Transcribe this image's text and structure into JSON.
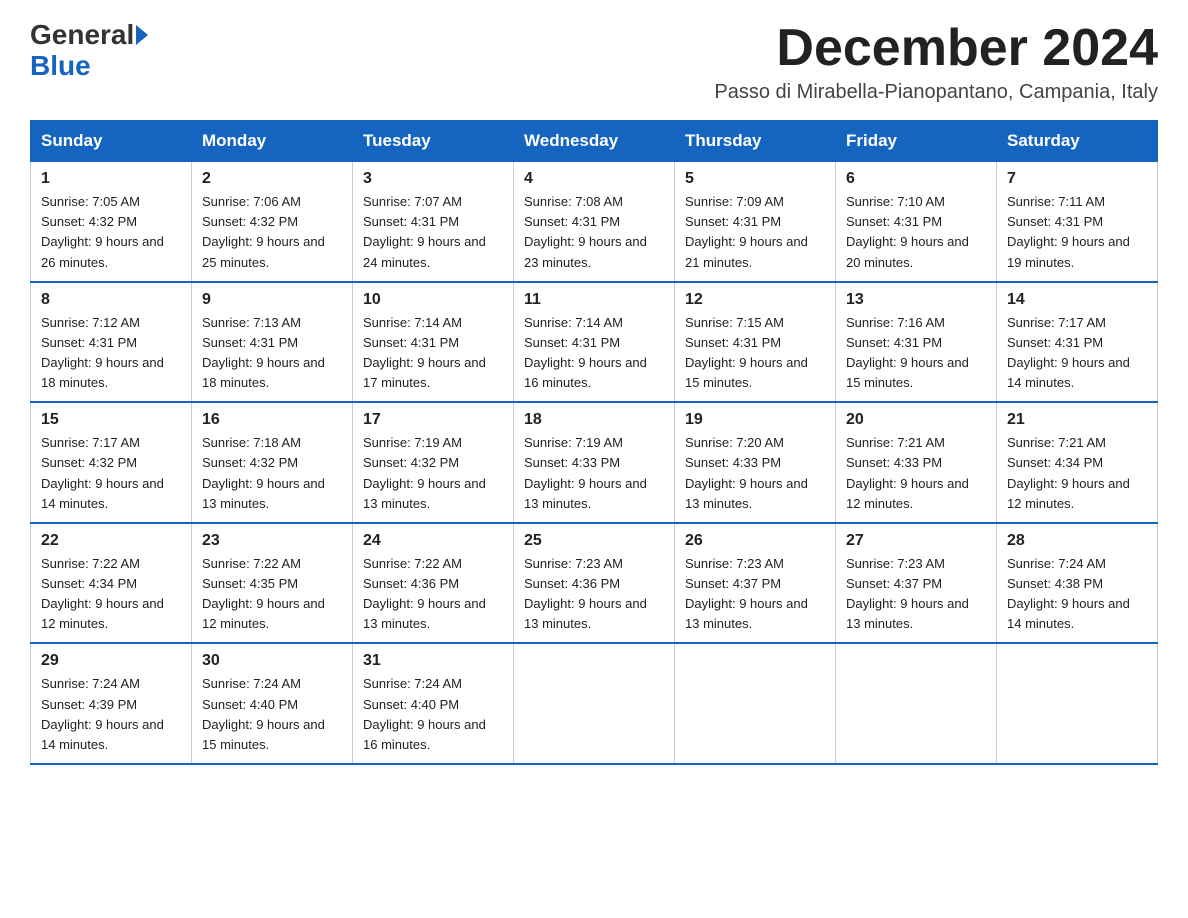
{
  "header": {
    "logo": {
      "general": "General",
      "blue": "Blue"
    },
    "title": "December 2024",
    "location": "Passo di Mirabella-Pianopantano, Campania, Italy"
  },
  "calendar": {
    "days_of_week": [
      "Sunday",
      "Monday",
      "Tuesday",
      "Wednesday",
      "Thursday",
      "Friday",
      "Saturday"
    ],
    "weeks": [
      [
        {
          "day": "1",
          "sunrise": "7:05 AM",
          "sunset": "4:32 PM",
          "daylight": "9 hours and 26 minutes."
        },
        {
          "day": "2",
          "sunrise": "7:06 AM",
          "sunset": "4:32 PM",
          "daylight": "9 hours and 25 minutes."
        },
        {
          "day": "3",
          "sunrise": "7:07 AM",
          "sunset": "4:31 PM",
          "daylight": "9 hours and 24 minutes."
        },
        {
          "day": "4",
          "sunrise": "7:08 AM",
          "sunset": "4:31 PM",
          "daylight": "9 hours and 23 minutes."
        },
        {
          "day": "5",
          "sunrise": "7:09 AM",
          "sunset": "4:31 PM",
          "daylight": "9 hours and 21 minutes."
        },
        {
          "day": "6",
          "sunrise": "7:10 AM",
          "sunset": "4:31 PM",
          "daylight": "9 hours and 20 minutes."
        },
        {
          "day": "7",
          "sunrise": "7:11 AM",
          "sunset": "4:31 PM",
          "daylight": "9 hours and 19 minutes."
        }
      ],
      [
        {
          "day": "8",
          "sunrise": "7:12 AM",
          "sunset": "4:31 PM",
          "daylight": "9 hours and 18 minutes."
        },
        {
          "day": "9",
          "sunrise": "7:13 AM",
          "sunset": "4:31 PM",
          "daylight": "9 hours and 18 minutes."
        },
        {
          "day": "10",
          "sunrise": "7:14 AM",
          "sunset": "4:31 PM",
          "daylight": "9 hours and 17 minutes."
        },
        {
          "day": "11",
          "sunrise": "7:14 AM",
          "sunset": "4:31 PM",
          "daylight": "9 hours and 16 minutes."
        },
        {
          "day": "12",
          "sunrise": "7:15 AM",
          "sunset": "4:31 PM",
          "daylight": "9 hours and 15 minutes."
        },
        {
          "day": "13",
          "sunrise": "7:16 AM",
          "sunset": "4:31 PM",
          "daylight": "9 hours and 15 minutes."
        },
        {
          "day": "14",
          "sunrise": "7:17 AM",
          "sunset": "4:31 PM",
          "daylight": "9 hours and 14 minutes."
        }
      ],
      [
        {
          "day": "15",
          "sunrise": "7:17 AM",
          "sunset": "4:32 PM",
          "daylight": "9 hours and 14 minutes."
        },
        {
          "day": "16",
          "sunrise": "7:18 AM",
          "sunset": "4:32 PM",
          "daylight": "9 hours and 13 minutes."
        },
        {
          "day": "17",
          "sunrise": "7:19 AM",
          "sunset": "4:32 PM",
          "daylight": "9 hours and 13 minutes."
        },
        {
          "day": "18",
          "sunrise": "7:19 AM",
          "sunset": "4:33 PM",
          "daylight": "9 hours and 13 minutes."
        },
        {
          "day": "19",
          "sunrise": "7:20 AM",
          "sunset": "4:33 PM",
          "daylight": "9 hours and 13 minutes."
        },
        {
          "day": "20",
          "sunrise": "7:21 AM",
          "sunset": "4:33 PM",
          "daylight": "9 hours and 12 minutes."
        },
        {
          "day": "21",
          "sunrise": "7:21 AM",
          "sunset": "4:34 PM",
          "daylight": "9 hours and 12 minutes."
        }
      ],
      [
        {
          "day": "22",
          "sunrise": "7:22 AM",
          "sunset": "4:34 PM",
          "daylight": "9 hours and 12 minutes."
        },
        {
          "day": "23",
          "sunrise": "7:22 AM",
          "sunset": "4:35 PM",
          "daylight": "9 hours and 12 minutes."
        },
        {
          "day": "24",
          "sunrise": "7:22 AM",
          "sunset": "4:36 PM",
          "daylight": "9 hours and 13 minutes."
        },
        {
          "day": "25",
          "sunrise": "7:23 AM",
          "sunset": "4:36 PM",
          "daylight": "9 hours and 13 minutes."
        },
        {
          "day": "26",
          "sunrise": "7:23 AM",
          "sunset": "4:37 PM",
          "daylight": "9 hours and 13 minutes."
        },
        {
          "day": "27",
          "sunrise": "7:23 AM",
          "sunset": "4:37 PM",
          "daylight": "9 hours and 13 minutes."
        },
        {
          "day": "28",
          "sunrise": "7:24 AM",
          "sunset": "4:38 PM",
          "daylight": "9 hours and 14 minutes."
        }
      ],
      [
        {
          "day": "29",
          "sunrise": "7:24 AM",
          "sunset": "4:39 PM",
          "daylight": "9 hours and 14 minutes."
        },
        {
          "day": "30",
          "sunrise": "7:24 AM",
          "sunset": "4:40 PM",
          "daylight": "9 hours and 15 minutes."
        },
        {
          "day": "31",
          "sunrise": "7:24 AM",
          "sunset": "4:40 PM",
          "daylight": "9 hours and 16 minutes."
        },
        null,
        null,
        null,
        null
      ]
    ]
  }
}
